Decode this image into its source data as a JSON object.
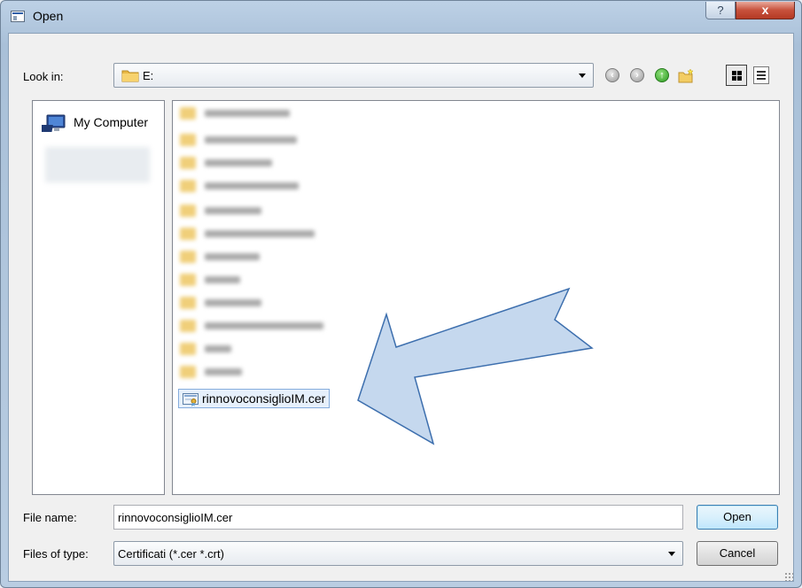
{
  "window": {
    "title": "Open",
    "help_label": "?",
    "close_label": "x"
  },
  "toolbar": {
    "look_in_label": "Look in:",
    "look_in_value": "E:"
  },
  "sidebar": {
    "items": [
      {
        "label": "My Computer",
        "icon": "my-computer-icon"
      }
    ]
  },
  "file_list": {
    "blurred_folder_count": 13,
    "selected_file": "rinnovoconsiglioIM.cer",
    "selected_file_icon": "certificate-icon"
  },
  "bottom": {
    "file_name_label": "File name:",
    "file_name_value": "rinnovoconsiglioIM.cer",
    "file_type_label": "Files of type:",
    "file_type_value": "Certificati (*.cer *.crt)",
    "open_label": "Open",
    "cancel_label": "Cancel"
  },
  "annotation": {
    "arrow_color": "#c5d8ee",
    "arrow_stroke": "#3d6fae"
  }
}
